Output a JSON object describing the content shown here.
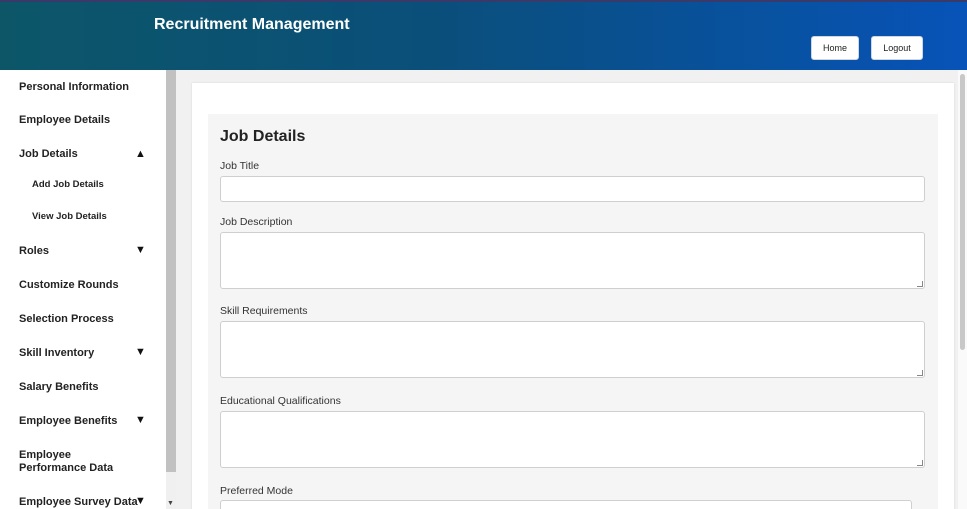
{
  "header": {
    "title": "Recruitment Management",
    "home_label": "Home",
    "logout_label": "Logout"
  },
  "sidebar": {
    "items": [
      {
        "label": "Personal Information",
        "caret": ""
      },
      {
        "label": "Employee Details",
        "caret": ""
      },
      {
        "label": "Job Details",
        "caret": "▲"
      },
      {
        "label": "Roles",
        "caret": "▼"
      },
      {
        "label": "Customize Rounds",
        "caret": ""
      },
      {
        "label": "Selection Process",
        "caret": ""
      },
      {
        "label": "Skill Inventory",
        "caret": "▼"
      },
      {
        "label": "Salary Benefits",
        "caret": ""
      },
      {
        "label": "Employee Benefits",
        "caret": "▼"
      },
      {
        "label": "Employee Performance Data",
        "caret": ""
      },
      {
        "label": "Employee Survey Data",
        "caret": "▼"
      }
    ],
    "sub_items": [
      {
        "label": "Add Job Details"
      },
      {
        "label": "View Job Details"
      }
    ]
  },
  "form": {
    "title": "Job Details",
    "fields": [
      {
        "label": "Job Title",
        "value": ""
      },
      {
        "label": "Job Description",
        "value": ""
      },
      {
        "label": "Skill Requirements",
        "value": ""
      },
      {
        "label": "Educational Qualifications",
        "value": ""
      },
      {
        "label": "Preferred Mode",
        "value": ""
      }
    ]
  },
  "colors": {
    "header_start": "#0c5668",
    "header_end": "#0753b8",
    "panel_bg": "#f5f5f5"
  }
}
